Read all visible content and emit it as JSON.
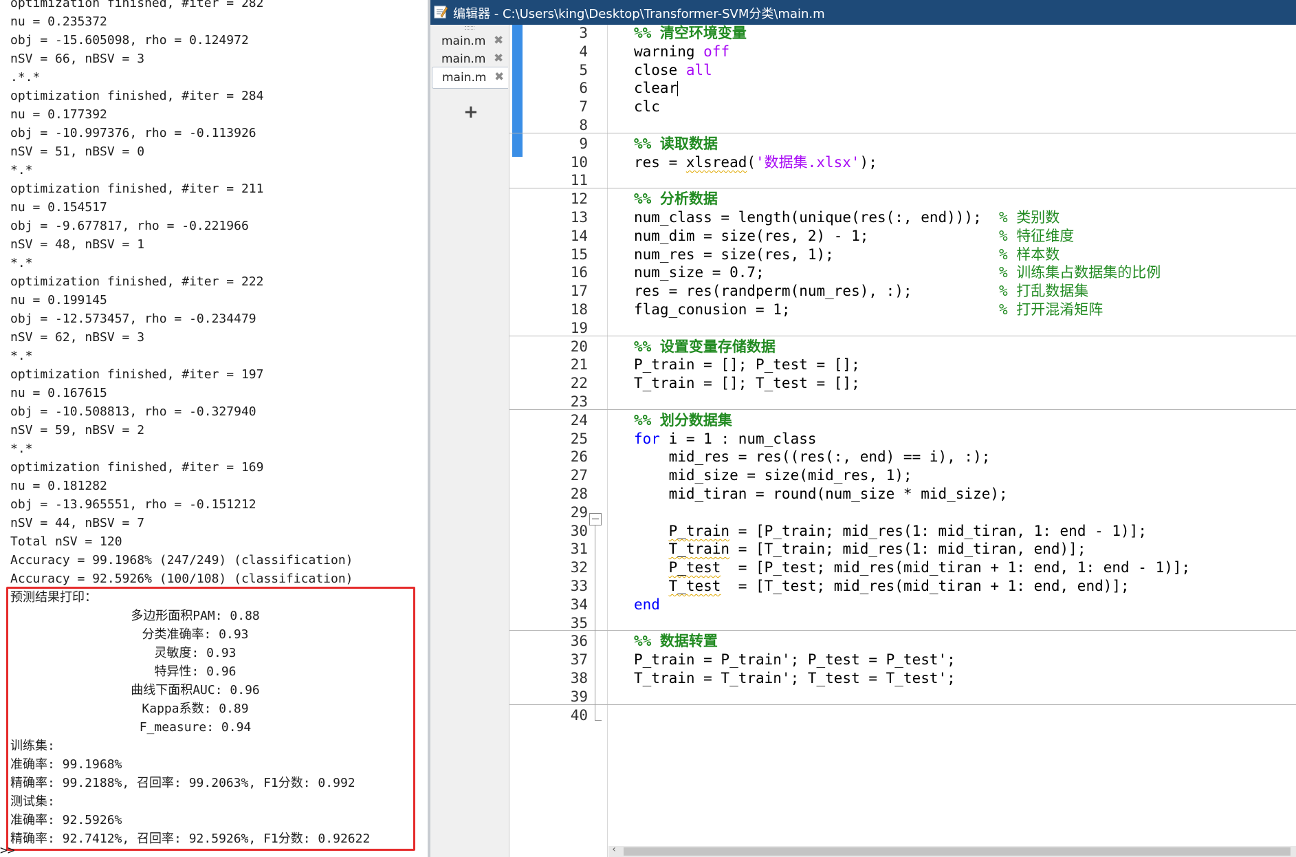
{
  "command_window": {
    "lines": [
      "optimization finished, #iter = 282",
      "nu = 0.235372",
      "obj = -15.605098, rho = 0.124972",
      "nSV = 66, nBSV = 3",
      ".*.*",
      "optimization finished, #iter = 284",
      "nu = 0.177392",
      "obj = -10.997376, rho = -0.113926",
      "nSV = 51, nBSV = 0",
      "*.*",
      "optimization finished, #iter = 211",
      "nu = 0.154517",
      "obj = -9.677817, rho = -0.221966",
      "nSV = 48, nBSV = 1",
      "*.*",
      "optimization finished, #iter = 222",
      "nu = 0.199145",
      "obj = -12.573457, rho = -0.234479",
      "nSV = 62, nBSV = 3",
      "*.*",
      "optimization finished, #iter = 197",
      "nu = 0.167615",
      "obj = -10.508813, rho = -0.327940",
      "nSV = 59, nBSV = 2",
      "*.*",
      "optimization finished, #iter = 169",
      "nu = 0.181282",
      "obj = -13.965551, rho = -0.151212",
      "nSV = 44, nBSV = 7",
      "Total nSV = 120",
      "Accuracy = 99.1968% (247/249) (classification)",
      "Accuracy = 92.5926% (100/108) (classification)"
    ],
    "results": {
      "header": "预测结果打印：",
      "metrics": [
        "多边形面积PAM: 0.88",
        "分类准确率: 0.93",
        "灵敏度: 0.93",
        "特异性: 0.96",
        "曲线下面积AUC: 0.96",
        "Kappa系数: 0.89",
        "F_measure: 0.94"
      ],
      "train_label": "训练集:",
      "train_accuracy": "准确率: 99.1968%",
      "train_detail": "精确率: 99.2188%, 召回率: 99.2063%, F1分数: 0.992",
      "test_label": "测试集:",
      "test_accuracy": "准确率: 92.5926%",
      "test_detail": "精确率: 92.7412%, 召回率: 92.5926%, F1分数: 0.92622"
    },
    "prompt": ">>"
  },
  "editor": {
    "title": "编辑器 - C:\\Users\\king\\Desktop\\Transformer-SVM分类\\main.m",
    "tabs": [
      {
        "label": "main.m",
        "close": "✖",
        "active": false
      },
      {
        "label": "main.m",
        "close": "✖",
        "active": false
      },
      {
        "label": "main.m",
        "close": "✖",
        "active": true
      }
    ],
    "add_tab_label": "+",
    "lines": [
      {
        "n": "3",
        "parts": [
          [
            "%% 清空环境变量",
            "sec"
          ]
        ]
      },
      {
        "n": "4",
        "parts": [
          [
            "warning ",
            ""
          ],
          [
            "off",
            "str"
          ]
        ]
      },
      {
        "n": "5",
        "parts": [
          [
            "close ",
            ""
          ],
          [
            "all",
            "str"
          ]
        ]
      },
      {
        "n": "6",
        "parts": [
          [
            "clear",
            ""
          ]
        ],
        "caret": true
      },
      {
        "n": "7",
        "parts": [
          [
            "clc",
            ""
          ]
        ]
      },
      {
        "n": "8",
        "parts": []
      },
      {
        "n": "9",
        "parts": [
          [
            "%% 读取数据",
            "sec"
          ]
        ],
        "separator": true
      },
      {
        "n": "10",
        "parts": [
          [
            "res = ",
            ""
          ],
          [
            "xlsread",
            "squig"
          ],
          [
            "(",
            ""
          ],
          [
            "'数据集.xlsx'",
            "str"
          ],
          [
            ");",
            ""
          ]
        ]
      },
      {
        "n": "11",
        "parts": []
      },
      {
        "n": "12",
        "parts": [
          [
            "%% 分析数据",
            "sec"
          ]
        ],
        "separator": true
      },
      {
        "n": "13",
        "parts": [
          [
            "num_class = length(unique(res(:, end)));  ",
            ""
          ],
          [
            "% 类别数",
            "cm"
          ]
        ]
      },
      {
        "n": "14",
        "parts": [
          [
            "num_dim = size(res, 2) - 1;               ",
            ""
          ],
          [
            "% 特征维度",
            "cm"
          ]
        ]
      },
      {
        "n": "15",
        "parts": [
          [
            "num_res = size(res, 1);                   ",
            ""
          ],
          [
            "% 样本数",
            "cm"
          ]
        ]
      },
      {
        "n": "16",
        "parts": [
          [
            "num_size = 0.7;                           ",
            ""
          ],
          [
            "% 训练集占数据集的比例",
            "cm"
          ]
        ]
      },
      {
        "n": "17",
        "parts": [
          [
            "res = res(randperm(num_res), :);          ",
            ""
          ],
          [
            "% 打乱数据集",
            "cm"
          ]
        ]
      },
      {
        "n": "18",
        "parts": [
          [
            "flag_conusion = 1;                        ",
            ""
          ],
          [
            "% 打开混淆矩阵",
            "cm"
          ]
        ]
      },
      {
        "n": "19",
        "parts": []
      },
      {
        "n": "20",
        "parts": [
          [
            "%% 设置变量存储数据",
            "sec"
          ]
        ],
        "separator": true
      },
      {
        "n": "21",
        "parts": [
          [
            "P_train = []; P_test = [];",
            ""
          ]
        ]
      },
      {
        "n": "22",
        "parts": [
          [
            "T_train = []; T_test = [];",
            ""
          ]
        ]
      },
      {
        "n": "23",
        "parts": []
      },
      {
        "n": "24",
        "parts": [
          [
            "%% 划分数据集",
            "sec"
          ]
        ],
        "separator": true
      },
      {
        "n": "25",
        "parts": [
          [
            "for",
            "kw"
          ],
          [
            " i = 1 : num_class",
            ""
          ]
        ]
      },
      {
        "n": "26",
        "parts": [
          [
            "    mid_res = res((res(:, end) == i), :);",
            ""
          ]
        ]
      },
      {
        "n": "27",
        "parts": [
          [
            "    mid_size = size(mid_res, 1);",
            ""
          ]
        ]
      },
      {
        "n": "28",
        "parts": [
          [
            "    mid_tiran = round(num_size * mid_size);",
            ""
          ]
        ]
      },
      {
        "n": "29",
        "parts": []
      },
      {
        "n": "30",
        "parts": [
          [
            "    ",
            ""
          ],
          [
            "P_train",
            "squig"
          ],
          [
            " = [P_train; mid_res(1: mid_tiran, 1: end - 1)];",
            ""
          ]
        ]
      },
      {
        "n": "31",
        "parts": [
          [
            "    ",
            ""
          ],
          [
            "T_train",
            "squig"
          ],
          [
            " = [T_train; mid_res(1: mid_tiran, end)];",
            ""
          ]
        ]
      },
      {
        "n": "32",
        "parts": [
          [
            "    ",
            ""
          ],
          [
            "P_test",
            "squig"
          ],
          [
            "  = [P_test; mid_res(mid_tiran + 1: end, 1: end - 1)];",
            ""
          ]
        ]
      },
      {
        "n": "33",
        "parts": [
          [
            "    ",
            ""
          ],
          [
            "T_test",
            "squig"
          ],
          [
            "  = [T_test; mid_res(mid_tiran + 1: end, end)];",
            ""
          ]
        ]
      },
      {
        "n": "34",
        "parts": [
          [
            "end",
            "kw"
          ]
        ]
      },
      {
        "n": "35",
        "parts": []
      },
      {
        "n": "36",
        "parts": [
          [
            "%% 数据转置",
            "sec"
          ]
        ],
        "separator": true
      },
      {
        "n": "37",
        "parts": [
          [
            "P_train = P_train'; P_test = P_test';",
            ""
          ]
        ]
      },
      {
        "n": "38",
        "parts": [
          [
            "T_train = T_train'; T_test = T_test';",
            ""
          ]
        ]
      },
      {
        "n": "39",
        "parts": []
      },
      {
        "n": "40",
        "parts": [],
        "separator": true
      }
    ]
  },
  "colors": {
    "title_bar": "#1e4a78",
    "highlight_box": "#e52b2b",
    "change_bar": "#3a8ee6",
    "keyword": "#0000ff",
    "string": "#a709f5",
    "comment": "#228b22"
  }
}
